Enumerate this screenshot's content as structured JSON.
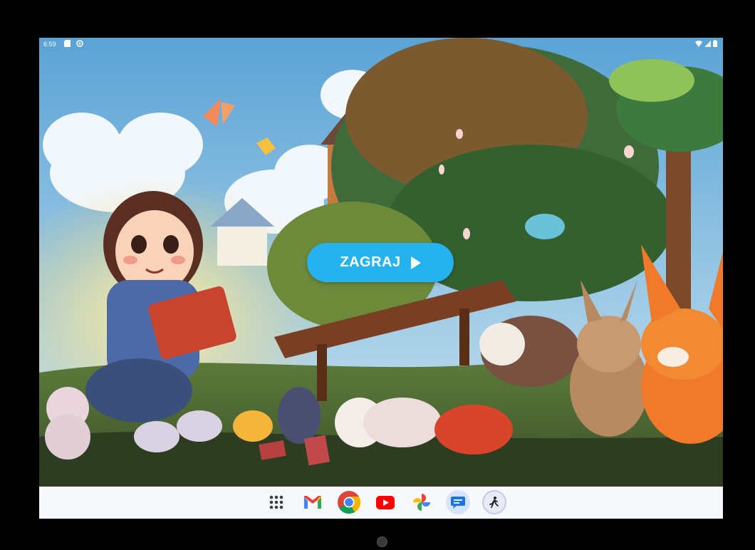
{
  "status_bar": {
    "time": "6:59",
    "icons_left": [
      "sd-card-icon",
      "circle-notification-icon"
    ],
    "icons_right": [
      "wifi-icon",
      "signal-icon",
      "battery-icon"
    ]
  },
  "main": {
    "play_button": {
      "label": "ZAGRAJ",
      "icon": "play-icon",
      "color": "#25b2ef"
    }
  },
  "taskbar": {
    "apps": [
      {
        "name": "app-drawer",
        "icon": "grid-dots-icon"
      },
      {
        "name": "gmail",
        "icon": "gmail-icon"
      },
      {
        "name": "chrome",
        "icon": "chrome-icon"
      },
      {
        "name": "youtube",
        "icon": "youtube-icon"
      },
      {
        "name": "photos",
        "icon": "photos-pinwheel-icon"
      },
      {
        "name": "messages",
        "icon": "messages-icon"
      },
      {
        "name": "accessibility-app",
        "icon": "running-figure-icon"
      }
    ]
  }
}
